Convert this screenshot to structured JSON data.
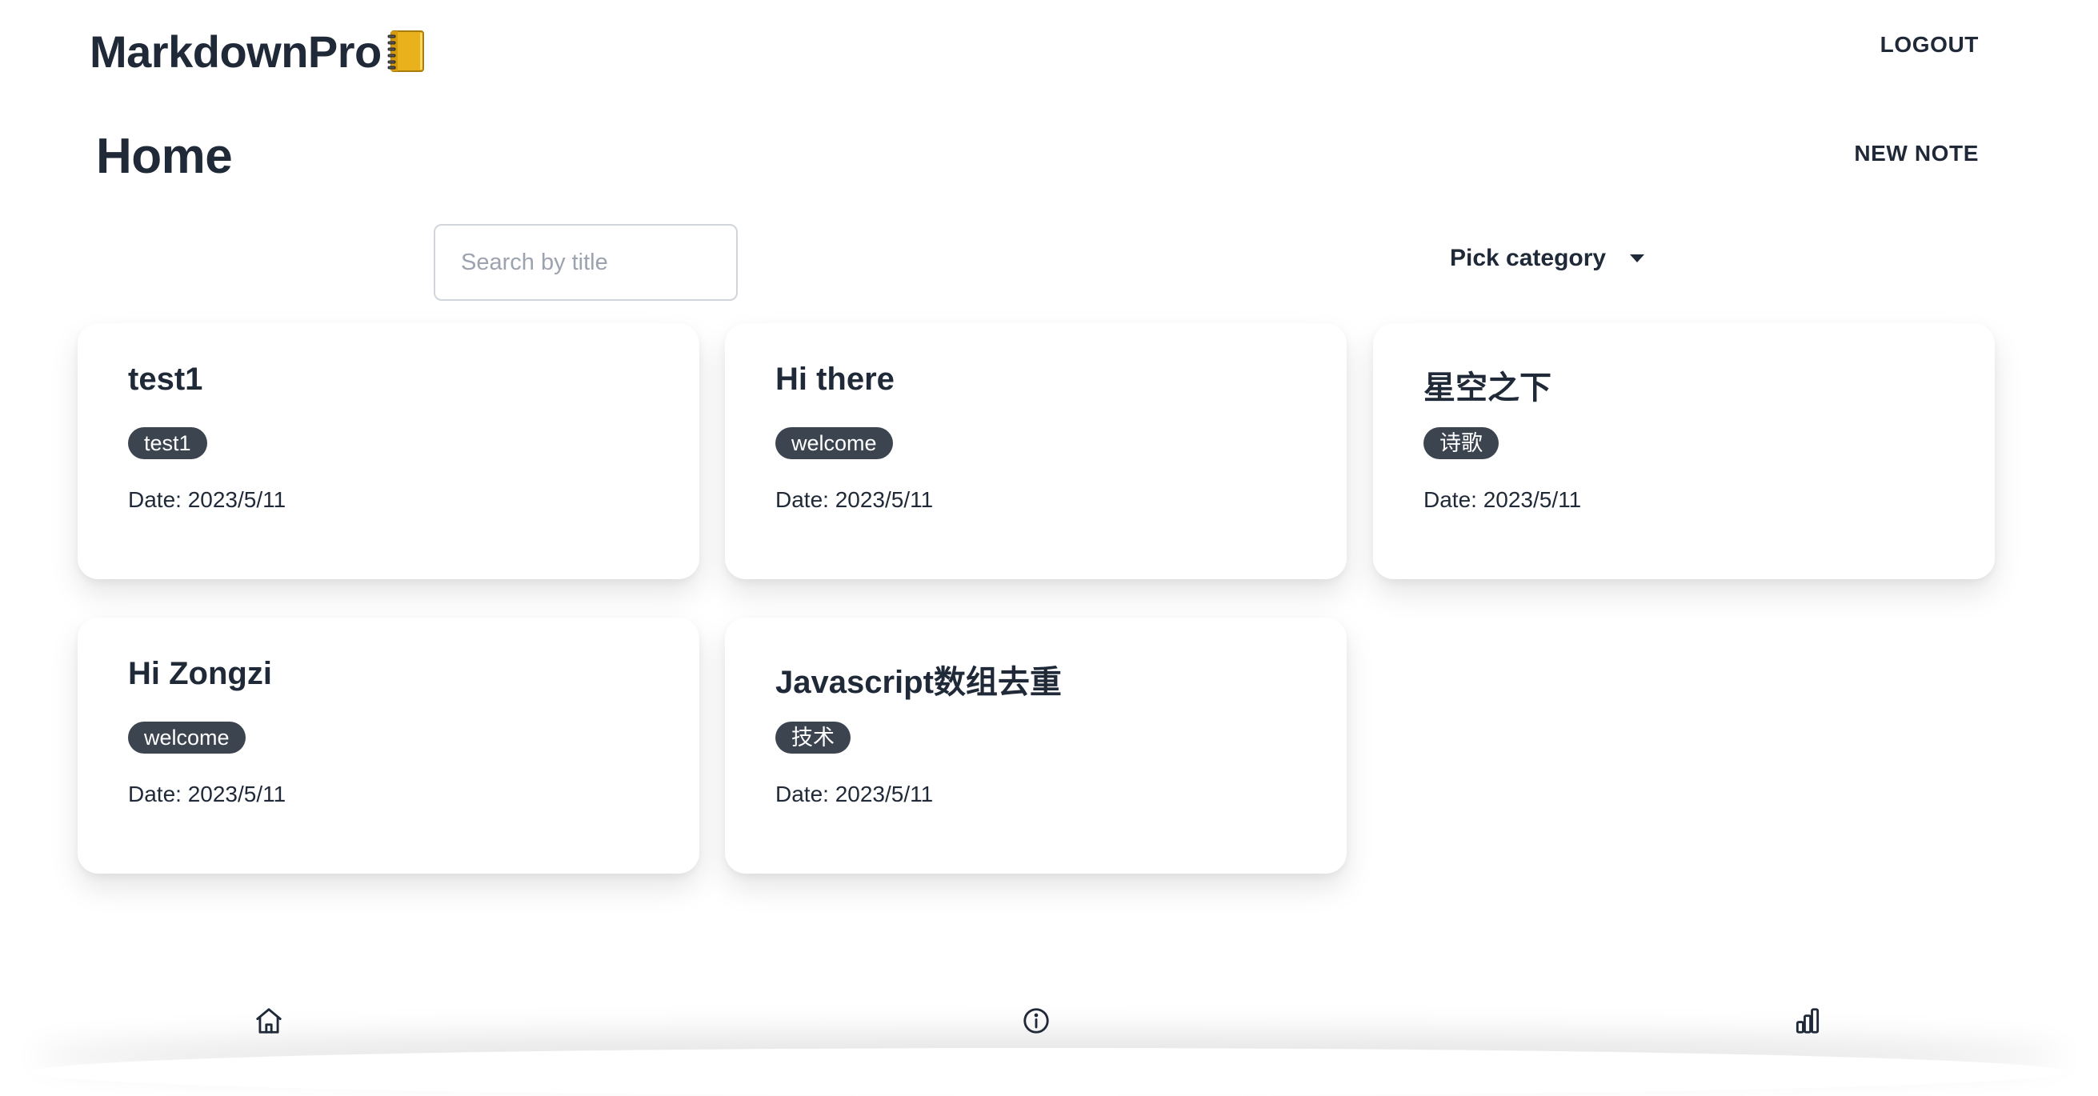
{
  "app": {
    "brand": "MarkdownPro",
    "brand_icon": "notebook-icon",
    "logout_label": "LOGOUT"
  },
  "page": {
    "title": "Home",
    "new_note_label": "NEW NOTE"
  },
  "filters": {
    "search_placeholder": "Search by title",
    "search_value": "",
    "category_label": "Pick category"
  },
  "notes": [
    {
      "title": "test1",
      "tag": "test1",
      "date": "Date: 2023/5/11"
    },
    {
      "title": "Hi there",
      "tag": "welcome",
      "date": "Date: 2023/5/11"
    },
    {
      "title": "星空之下",
      "tag": "诗歌",
      "date": "Date: 2023/5/11"
    },
    {
      "title": "Hi Zongzi",
      "tag": "welcome",
      "date": "Date: 2023/5/11"
    },
    {
      "title": "Javascript数组去重",
      "tag": "技术",
      "date": "Date: 2023/5/11"
    }
  ],
  "bottom_nav": {
    "items": [
      {
        "icon": "home-icon"
      },
      {
        "icon": "info-icon"
      },
      {
        "icon": "chart-icon"
      }
    ]
  },
  "colors": {
    "text": "#1f2937",
    "tag_bg": "#3c4450",
    "tag_text": "#ffffff",
    "placeholder": "#9ca3af",
    "border": "#d1d5db"
  }
}
